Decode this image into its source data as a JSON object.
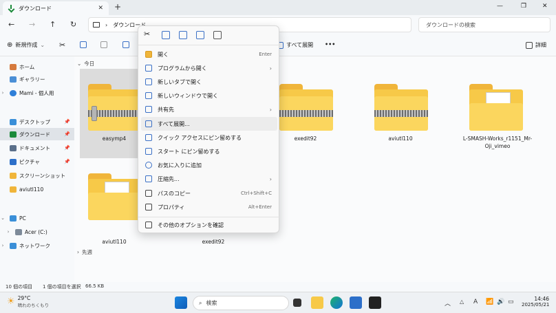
{
  "window": {
    "tab_title": "ダウンロード",
    "tab_close": "✕",
    "new_tab": "+",
    "minimize": "—",
    "maximize": "❐",
    "close": "✕"
  },
  "nav": {
    "back": "←",
    "forward": "→",
    "up": "↑",
    "refresh": "↻",
    "breadcrumb_chevron": "›",
    "breadcrumb": "ダウンロード",
    "search_placeholder": "ダウンロードの検索"
  },
  "toolbar": {
    "new_label": "新規作成",
    "new_chevron": "⌄",
    "extract_all_label": "すべて展開",
    "more": "•••",
    "details_label": "詳細"
  },
  "sidebar": {
    "items": [
      {
        "label": "ホーム",
        "chev": "",
        "pin": ""
      },
      {
        "label": "ギャラリー",
        "chev": "",
        "pin": ""
      },
      {
        "label": "Mami - 個人用",
        "chev": "›",
        "pin": ""
      },
      {
        "label": "デスクトップ",
        "chev": "",
        "pin": "📌"
      },
      {
        "label": "ダウンロード",
        "chev": "",
        "pin": "📌"
      },
      {
        "label": "ドキュメント",
        "chev": "",
        "pin": "📌"
      },
      {
        "label": "ピクチャ",
        "chev": "",
        "pin": "📌"
      },
      {
        "label": "スクリーンショット",
        "chev": "",
        "pin": ""
      },
      {
        "label": "aviutl110",
        "chev": "",
        "pin": ""
      },
      {
        "label": "PC",
        "chev": "⌄",
        "pin": ""
      },
      {
        "label": "Acer (C:)",
        "chev": "›",
        "pin": ""
      },
      {
        "label": "ネットワーク",
        "chev": "›",
        "pin": ""
      }
    ]
  },
  "main": {
    "group_today": "今日",
    "group_last_week": "先週",
    "group_chevron_open": "⌄",
    "group_chevron_closed": "›",
    "files": [
      {
        "name": "easymp4"
      },
      {
        "name": "exedit92"
      },
      {
        "name": "aviutl110"
      },
      {
        "name": "L-SMASH-Works_r1151_Mr-Oji_vimeo"
      },
      {
        "name": "aviutl110"
      },
      {
        "name": "exedit92"
      }
    ]
  },
  "context_menu": {
    "items": [
      {
        "label": "開く",
        "shortcut": "Enter",
        "arrow": ""
      },
      {
        "label": "プログラムから開く",
        "shortcut": "",
        "arrow": "›"
      },
      {
        "label": "新しいタブで開く",
        "shortcut": "",
        "arrow": ""
      },
      {
        "label": "新しいウィンドウで開く",
        "shortcut": "",
        "arrow": ""
      },
      {
        "label": "共有先",
        "shortcut": "",
        "arrow": "›"
      },
      {
        "label": "すべて展開...",
        "shortcut": "",
        "arrow": ""
      },
      {
        "label": "クイック アクセスにピン留めする",
        "shortcut": "",
        "arrow": ""
      },
      {
        "label": "スタート にピン留めする",
        "shortcut": "",
        "arrow": ""
      },
      {
        "label": "お気に入りに追加",
        "shortcut": "",
        "arrow": ""
      },
      {
        "label": "圧縮先...",
        "shortcut": "",
        "arrow": "›"
      },
      {
        "label": "パスのコピー",
        "shortcut": "Ctrl+Shift+C",
        "arrow": ""
      },
      {
        "label": "プロパティ",
        "shortcut": "Alt+Enter",
        "arrow": ""
      },
      {
        "label": "その他のオプションを確認",
        "shortcut": "",
        "arrow": ""
      }
    ]
  },
  "status": {
    "item_count": "10 個の項目",
    "selection": "1 個の項目を選択",
    "size": "66.5 KB"
  },
  "taskbar": {
    "weather_temp": "29°C",
    "weather_desc": "晴れのちくもり",
    "search_label": "検索",
    "tray_chevron": "︿",
    "ime": "A",
    "time": "14:46",
    "date": "2025/05/21"
  },
  "colors": {
    "accent": "#3b70c6",
    "folder": "#f7c948",
    "selection": "#dcdcdc"
  }
}
